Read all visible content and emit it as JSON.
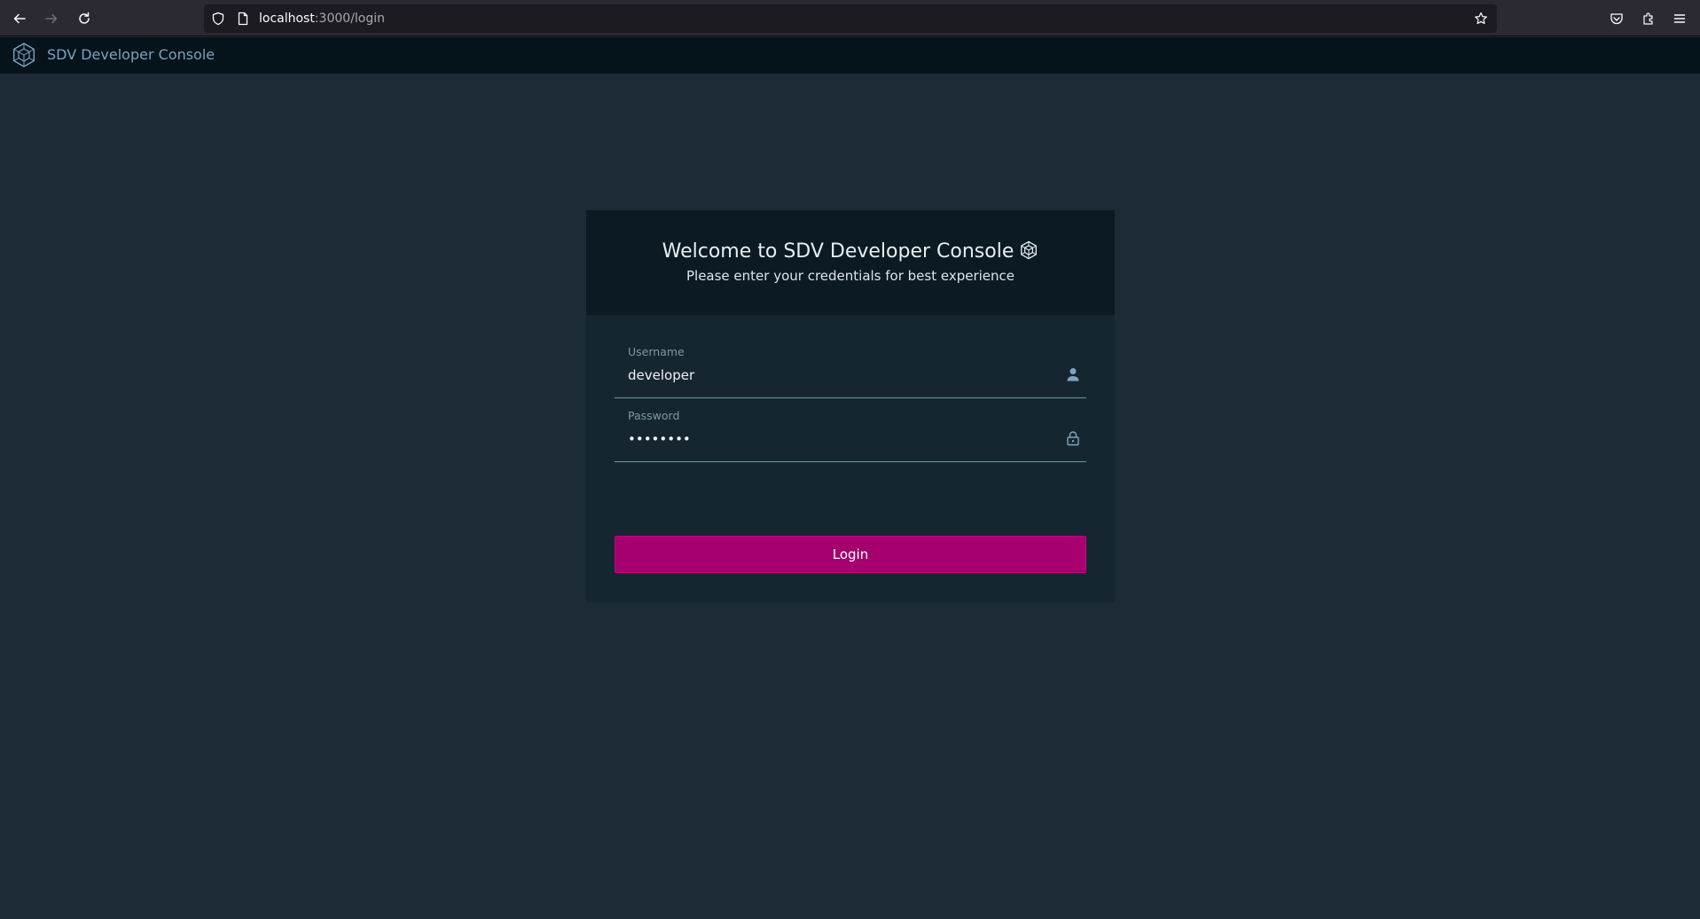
{
  "browser": {
    "url_host": "localhost",
    "url_path": ":3000/login",
    "icons": [
      "back-icon",
      "forward-icon",
      "reload-icon",
      "shield-icon",
      "page-icon",
      "bookmark-star-icon",
      "pocket-icon",
      "extensions-icon",
      "menu-icon"
    ]
  },
  "app": {
    "title": "SDV Developer Console",
    "logo_icon": "hexagon-cube-logo-icon"
  },
  "login": {
    "title": "Welcome to SDV Developer Console",
    "subtitle": "Please enter your credentials for best experience",
    "username_label": "Username",
    "username_value": "developer",
    "username_icon": "user-icon",
    "password_label": "Password",
    "password_value": "password",
    "password_icon": "lock-icon",
    "login_button": "Login"
  },
  "colors": {
    "page_bg": "#1c2b35",
    "header_bg": "#05131b",
    "card_bg": "#162630",
    "card_head_bg": "#0b1a23",
    "accent": "#a5006e",
    "header_text": "#7aa3bd"
  }
}
